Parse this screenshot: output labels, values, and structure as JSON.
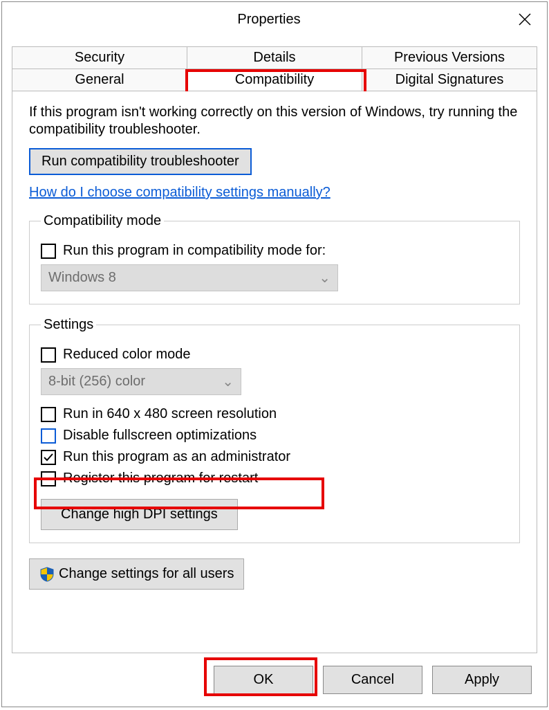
{
  "window": {
    "title": "Properties"
  },
  "tabs": {
    "row1": [
      "Security",
      "Details",
      "Previous Versions"
    ],
    "row2": [
      "General",
      "Compatibility",
      "Digital Signatures"
    ],
    "active": "Compatibility"
  },
  "intro": "If this program isn't working correctly on this version of Windows, try running the compatibility troubleshooter.",
  "buttons": {
    "troubleshoot": "Run compatibility troubleshooter",
    "dpi": "Change high DPI settings",
    "all_users": "Change settings for all users",
    "ok": "OK",
    "cancel": "Cancel",
    "apply": "Apply"
  },
  "link": "How do I choose compatibility settings manually? ",
  "groups": {
    "compat_mode": {
      "legend": "Compatibility mode",
      "checkbox_label": "Run this program in compatibility mode for:",
      "select_value": "Windows 8"
    },
    "settings": {
      "legend": "Settings",
      "reduced_color": "Reduced color mode",
      "color_select": "8-bit (256) color",
      "res": "Run in 640 x 480 screen resolution",
      "fullscreen": "Disable fullscreen optimizations",
      "admin": "Run this program as an administrator",
      "restart": "Register this program for restart"
    }
  }
}
